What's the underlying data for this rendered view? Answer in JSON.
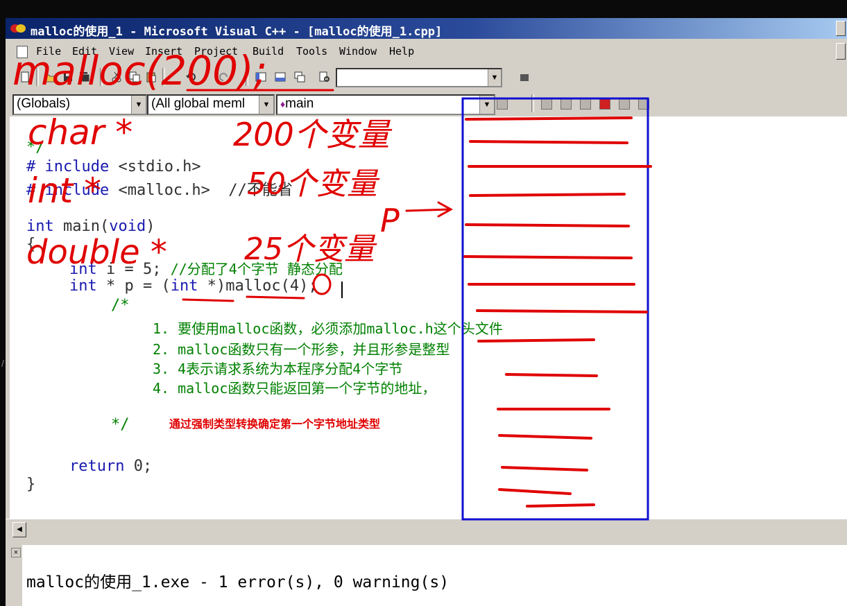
{
  "window": {
    "title": "malloc的使用_1 - Microsoft Visual C++ - [malloc的使用_1.cpp]"
  },
  "menu": [
    "File",
    "Edit",
    "View",
    "Insert",
    "Project",
    "Build",
    "Tools",
    "Window",
    "Help"
  ],
  "toolbar": {
    "find_value": "",
    "combos": {
      "scope": "(Globals)",
      "members": "(All global meml",
      "function": "main"
    }
  },
  "code": {
    "line_comment_end": "*/",
    "include1_hash": "# include",
    "include1_rest": " <stdio.h>",
    "include2_hash": "# include",
    "include2_rest": " <malloc.h>  //不能省",
    "main_kw1": "int",
    "main_rest": " main(",
    "main_kw2": "void",
    "main_close": ")",
    "brace_open": "{",
    "l1_kw": "int",
    "l1_rest": " i = 5; ",
    "l1_comment": "//分配了4个字节 静态分配",
    "l2_kw1": "int",
    "l2_mid1": " * p = (",
    "l2_kw2": "int",
    "l2_rest": " *)malloc(4);",
    "c_open": "/*",
    "notes": [
      "1. 要使用malloc函数，必须添加malloc.h这个头文件",
      "2. malloc函数只有一个形参，并且形参是整型",
      "3. 4表示请求系统为本程序分配4个字节",
      "4. malloc函数只能返回第一个字节的地址，"
    ],
    "c_close": "*/",
    "annotation": "通过强制类型转换确定第一个字节地址类型",
    "return_kw": "return",
    "return_rest": " 0;",
    "brace_close": "}"
  },
  "output": {
    "message": "malloc的使用_1.exe - 1 error(s), 0 warning(s)"
  },
  "handwriting": {
    "l1": "malloc(200);",
    "l2a": "char *",
    "l2b": "200个变量",
    "l3a": "int *",
    "l3b": "50个变量",
    "l4a": "double *",
    "l4b": "25个变量",
    "p": "P"
  },
  "colors": {
    "annotation_red": "#e00000",
    "memory_box_blue": "#1010d0",
    "keyword_blue": "#1a1ab0",
    "comment_green": "#008000",
    "window_face": "#d4d0c8"
  },
  "icons": [
    "app-icon",
    "new-file-icon",
    "open-folder-icon",
    "save-icon",
    "save-all-icon",
    "cut-icon",
    "copy-icon",
    "paste-icon",
    "undo-icon",
    "redo-icon",
    "workspace-icon",
    "output-icon",
    "window-list-icon",
    "find-in-files-icon",
    "wizard-icon",
    "close-icon"
  ]
}
